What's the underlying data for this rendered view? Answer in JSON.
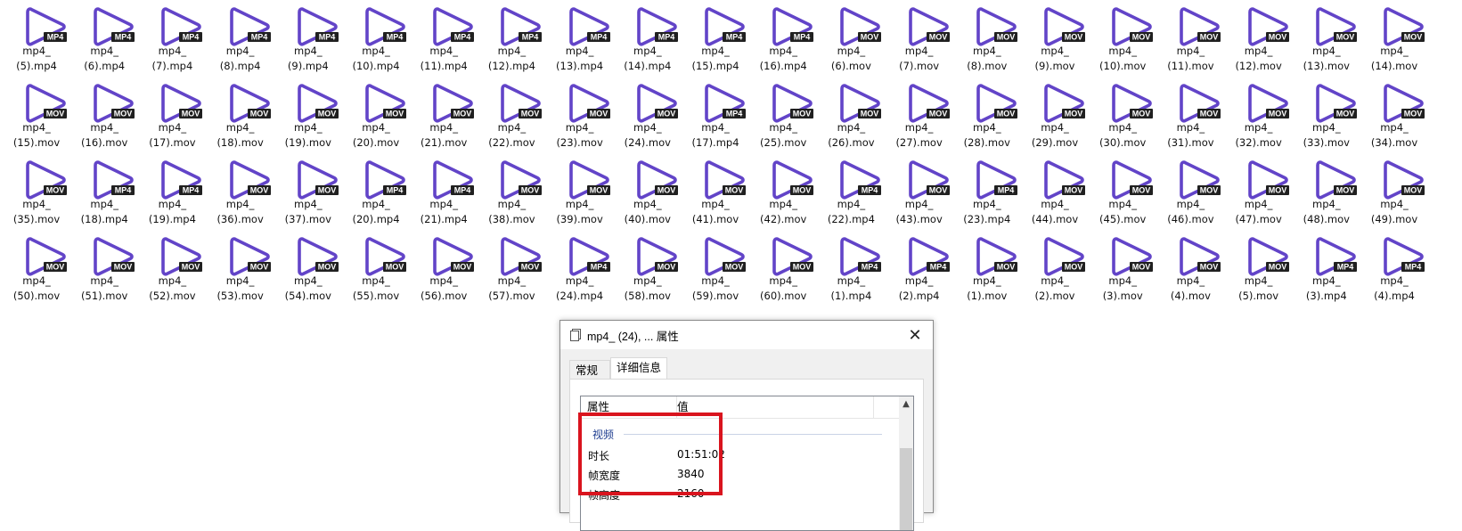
{
  "colors": {
    "icon_purple": "#6244c8",
    "badge_bg": "#202020",
    "badge_text": "#ffffff",
    "highlight_red": "#d9141e"
  },
  "files": [
    {
      "line1": "mp4_",
      "line2": "(5).mp4",
      "badge": "MP4"
    },
    {
      "line1": "mp4_",
      "line2": "(6).mp4",
      "badge": "MP4"
    },
    {
      "line1": "mp4_",
      "line2": "(7).mp4",
      "badge": "MP4"
    },
    {
      "line1": "mp4_",
      "line2": "(8).mp4",
      "badge": "MP4"
    },
    {
      "line1": "mp4_",
      "line2": "(9).mp4",
      "badge": "MP4"
    },
    {
      "line1": "mp4_",
      "line2": "(10).mp4",
      "badge": "MP4"
    },
    {
      "line1": "mp4_",
      "line2": "(11).mp4",
      "badge": "MP4"
    },
    {
      "line1": "mp4_",
      "line2": "(12).mp4",
      "badge": "MP4"
    },
    {
      "line1": "mp4_",
      "line2": "(13).mp4",
      "badge": "MP4"
    },
    {
      "line1": "mp4_",
      "line2": "(14).mp4",
      "badge": "MP4"
    },
    {
      "line1": "mp4_",
      "line2": "(15).mp4",
      "badge": "MP4"
    },
    {
      "line1": "mp4_",
      "line2": "(16).mp4",
      "badge": "MP4"
    },
    {
      "line1": "mp4_",
      "line2": "(6).mov",
      "badge": "MOV"
    },
    {
      "line1": "mp4_",
      "line2": "(7).mov",
      "badge": "MOV"
    },
    {
      "line1": "mp4_",
      "line2": "(8).mov",
      "badge": "MOV"
    },
    {
      "line1": "mp4_",
      "line2": "(9).mov",
      "badge": "MOV"
    },
    {
      "line1": "mp4_",
      "line2": "(10).mov",
      "badge": "MOV"
    },
    {
      "line1": "mp4_",
      "line2": "(11).mov",
      "badge": "MOV"
    },
    {
      "line1": "mp4_",
      "line2": "(12).mov",
      "badge": "MOV"
    },
    {
      "line1": "mp4_",
      "line2": "(13).mov",
      "badge": "MOV"
    },
    {
      "line1": "mp4_",
      "line2": "(14).mov",
      "badge": "MOV"
    },
    {
      "line1": "mp4_",
      "line2": "(15).mov",
      "badge": "MOV"
    },
    {
      "line1": "mp4_",
      "line2": "(16).mov",
      "badge": "MOV"
    },
    {
      "line1": "mp4_",
      "line2": "(17).mov",
      "badge": "MOV"
    },
    {
      "line1": "mp4_",
      "line2": "(18).mov",
      "badge": "MOV"
    },
    {
      "line1": "mp4_",
      "line2": "(19).mov",
      "badge": "MOV"
    },
    {
      "line1": "mp4_",
      "line2": "(20).mov",
      "badge": "MOV"
    },
    {
      "line1": "mp4_",
      "line2": "(21).mov",
      "badge": "MOV"
    },
    {
      "line1": "mp4_",
      "line2": "(22).mov",
      "badge": "MOV"
    },
    {
      "line1": "mp4_",
      "line2": "(23).mov",
      "badge": "MOV"
    },
    {
      "line1": "mp4_",
      "line2": "(24).mov",
      "badge": "MOV"
    },
    {
      "line1": "mp4_",
      "line2": "(17).mp4",
      "badge": "MP4"
    },
    {
      "line1": "mp4_",
      "line2": "(25).mov",
      "badge": "MOV"
    },
    {
      "line1": "mp4_",
      "line2": "(26).mov",
      "badge": "MOV"
    },
    {
      "line1": "mp4_",
      "line2": "(27).mov",
      "badge": "MOV"
    },
    {
      "line1": "mp4_",
      "line2": "(28).mov",
      "badge": "MOV"
    },
    {
      "line1": "mp4_",
      "line2": "(29).mov",
      "badge": "MOV"
    },
    {
      "line1": "mp4_",
      "line2": "(30).mov",
      "badge": "MOV"
    },
    {
      "line1": "mp4_",
      "line2": "(31).mov",
      "badge": "MOV"
    },
    {
      "line1": "mp4_",
      "line2": "(32).mov",
      "badge": "MOV"
    },
    {
      "line1": "mp4_",
      "line2": "(33).mov",
      "badge": "MOV"
    },
    {
      "line1": "mp4_",
      "line2": "(34).mov",
      "badge": "MOV"
    },
    {
      "line1": "mp4_",
      "line2": "(35).mov",
      "badge": "MOV"
    },
    {
      "line1": "mp4_",
      "line2": "(18).mp4",
      "badge": "MP4"
    },
    {
      "line1": "mp4_",
      "line2": "(19).mp4",
      "badge": "MP4"
    },
    {
      "line1": "mp4_",
      "line2": "(36).mov",
      "badge": "MOV"
    },
    {
      "line1": "mp4_",
      "line2": "(37).mov",
      "badge": "MOV"
    },
    {
      "line1": "mp4_",
      "line2": "(20).mp4",
      "badge": "MP4"
    },
    {
      "line1": "mp4_",
      "line2": "(21).mp4",
      "badge": "MP4"
    },
    {
      "line1": "mp4_",
      "line2": "(38).mov",
      "badge": "MOV"
    },
    {
      "line1": "mp4_",
      "line2": "(39).mov",
      "badge": "MOV"
    },
    {
      "line1": "mp4_",
      "line2": "(40).mov",
      "badge": "MOV"
    },
    {
      "line1": "mp4_",
      "line2": "(41).mov",
      "badge": "MOV"
    },
    {
      "line1": "mp4_",
      "line2": "(42).mov",
      "badge": "MOV"
    },
    {
      "line1": "mp4_",
      "line2": "(22).mp4",
      "badge": "MP4"
    },
    {
      "line1": "mp4_",
      "line2": "(43).mov",
      "badge": "MOV"
    },
    {
      "line1": "mp4_",
      "line2": "(23).mp4",
      "badge": "MP4"
    },
    {
      "line1": "mp4_",
      "line2": "(44).mov",
      "badge": "MOV"
    },
    {
      "line1": "mp4_",
      "line2": "(45).mov",
      "badge": "MOV"
    },
    {
      "line1": "mp4_",
      "line2": "(46).mov",
      "badge": "MOV"
    },
    {
      "line1": "mp4_",
      "line2": "(47).mov",
      "badge": "MOV"
    },
    {
      "line1": "mp4_",
      "line2": "(48).mov",
      "badge": "MOV"
    },
    {
      "line1": "mp4_",
      "line2": "(49).mov",
      "badge": "MOV"
    },
    {
      "line1": "mp4_",
      "line2": "(50).mov",
      "badge": "MOV"
    },
    {
      "line1": "mp4_",
      "line2": "(51).mov",
      "badge": "MOV"
    },
    {
      "line1": "mp4_",
      "line2": "(52).mov",
      "badge": "MOV"
    },
    {
      "line1": "mp4_",
      "line2": "(53).mov",
      "badge": "MOV"
    },
    {
      "line1": "mp4_",
      "line2": "(54).mov",
      "badge": "MOV"
    },
    {
      "line1": "mp4_",
      "line2": "(55).mov",
      "badge": "MOV"
    },
    {
      "line1": "mp4_",
      "line2": "(56).mov",
      "badge": "MOV"
    },
    {
      "line1": "mp4_",
      "line2": "(57).mov",
      "badge": "MOV"
    },
    {
      "line1": "mp4_",
      "line2": "(24).mp4",
      "badge": "MP4"
    },
    {
      "line1": "mp4_",
      "line2": "(58).mov",
      "badge": "MOV"
    },
    {
      "line1": "mp4_",
      "line2": "(59).mov",
      "badge": "MOV"
    },
    {
      "line1": "mp4_",
      "line2": "(60).mov",
      "badge": "MOV"
    },
    {
      "line1": "mp4_",
      "line2": "(1).mp4",
      "badge": "MP4"
    },
    {
      "line1": "mp4_",
      "line2": "(2).mp4",
      "badge": "MP4"
    },
    {
      "line1": "mp4_",
      "line2": "(1).mov",
      "badge": "MOV"
    },
    {
      "line1": "mp4_",
      "line2": "(2).mov",
      "badge": "MOV"
    },
    {
      "line1": "mp4_",
      "line2": "(3).mov",
      "badge": "MOV"
    },
    {
      "line1": "mp4_",
      "line2": "(4).mov",
      "badge": "MOV"
    },
    {
      "line1": "mp4_",
      "line2": "(5).mov",
      "badge": "MOV"
    },
    {
      "line1": "mp4_",
      "line2": "(3).mp4",
      "badge": "MP4"
    },
    {
      "line1": "mp4_",
      "line2": "(4).mp4",
      "badge": "MP4"
    }
  ],
  "dialog": {
    "title": "mp4_ (24), ... 属性",
    "close_glyph": "✕",
    "tabs": {
      "general": "常规",
      "details": "详细信息"
    },
    "columns": {
      "property": "属性",
      "value": "值"
    },
    "group_video": "视频",
    "rows": {
      "duration": {
        "name": "时长",
        "value": "01:51:02"
      },
      "frame_width": {
        "name": "帧宽度",
        "value": "3840"
      },
      "frame_height": {
        "name": "帧高度",
        "value": "2160"
      }
    },
    "scroll_up_glyph": "▲"
  }
}
